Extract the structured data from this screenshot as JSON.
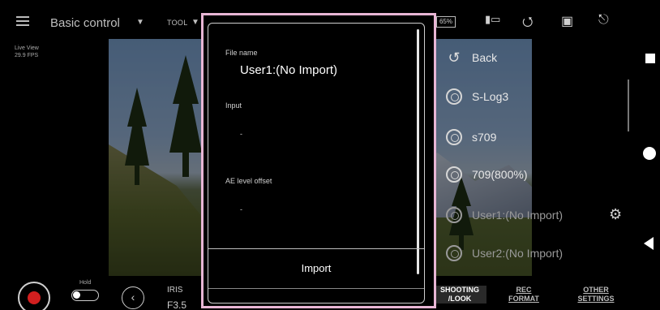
{
  "topbar": {
    "mode_label": "Basic control",
    "tool_label": "TOOL",
    "battery_label": "65%"
  },
  "live_view": {
    "line1": "Live View",
    "line2": "29.9 FPS"
  },
  "dialog": {
    "file_name_label": "File name",
    "file_name_value": "User1:(No Import)",
    "input_label": "Input",
    "input_value": "-",
    "ae_label": "AE level offset",
    "ae_value": "-",
    "import_label": "Import"
  },
  "menu": {
    "back": "Back",
    "items": [
      "S-Log3",
      "s709",
      "709(800%)",
      "User1:(No Import)",
      "User2:(No Import)"
    ]
  },
  "bottombar": {
    "hold_label": "Hold",
    "iris_label": "IRIS",
    "iris_value": "F3.5",
    "tabs": [
      {
        "line1": "SHOOTING",
        "line2": "/LOOK"
      },
      {
        "line1": "REC",
        "line2": "FORMAT"
      },
      {
        "line1": "OTHER",
        "line2": "SETTINGS"
      }
    ]
  },
  "icons": {
    "back": "↺",
    "gear": "⚙",
    "chevron_left": "‹",
    "caret": "▼"
  }
}
